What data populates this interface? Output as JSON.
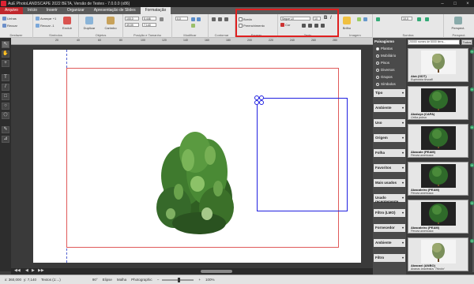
{
  "window": {
    "title": "AuE PhotoLANDSCAPE 2022 BETA, Versão de Testes - 7.0.0.0 (x86)"
  },
  "tabs": [
    {
      "label": "Arquivo",
      "kind": "file"
    },
    {
      "label": "Início",
      "kind": "normal"
    },
    {
      "label": "Inserir",
      "kind": "normal"
    },
    {
      "label": "Organizar",
      "kind": "normal"
    },
    {
      "label": "Apresentação de Slides",
      "kind": "normal"
    },
    {
      "label": "Formatação",
      "kind": "active"
    }
  ],
  "ribbon": {
    "groups": {
      "desfazer": "Desfazer",
      "simbolos": "Símbolos",
      "objetos": "Objetos",
      "posicao": "Posição e Tamanho",
      "modificar": "Modificar",
      "contornar": "Contornar",
      "formas": "Formas",
      "texto": "Texto",
      "imagem": "Imagem",
      "sombra": "Sombra",
      "perspect": "Perspect."
    },
    "items": {
      "linhas": "Linhas",
      "recuar": "Recuar",
      "avancar": "Avançar +1",
      "recuar1": "Recuar -1",
      "excluir": "Excluir",
      "duplicar": "Duplicar",
      "carimbo": "Carimbo",
      "borda": "Borda",
      "preenchimento": "Preenchimento",
      "cor": "Cor",
      "brilho": "Brilho",
      "perspect": "Perspect."
    },
    "font_name": "Segoe UI",
    "font_size": "10",
    "pos_x": "100,0",
    "pos_y": "49,09",
    "width": "5,446",
    "height": "7,140",
    "angle": "0,0",
    "shadow_offset": "10,0"
  },
  "ruler": {
    "ticks": [
      "20",
      "40",
      "60",
      "80",
      "100",
      "120",
      "140",
      "160",
      "180",
      "200",
      "220",
      "240",
      "260",
      "280"
    ]
  },
  "statusbar": {
    "coords": "x: 360,000",
    "coords_y": "y: 7,140",
    "layer": "Textos (1:...)",
    "angle": "90°",
    "snap": "Elipse",
    "grid": "Malha",
    "mode": "Photographic",
    "zoom": "100%"
  },
  "panel": {
    "type_heading": "Paisagismo",
    "types": [
      {
        "label": "Plantas",
        "on": true
      },
      {
        "label": "Mobiliário",
        "on": false
      },
      {
        "label": "Pisos",
        "on": false
      },
      {
        "label": "Diversos",
        "on": false
      },
      {
        "label": "Grupos",
        "on": false
      },
      {
        "label": "Símbolos",
        "on": false
      }
    ],
    "filters": [
      "Tipo",
      "Ambiente",
      "Uso",
      "Origem",
      "Folha",
      "Favoritos",
      "Mais usados",
      "Usado recentemente",
      "Filtro (LMO)",
      "Fornecedor",
      "Ambiente",
      "Filtro"
    ],
    "search": "20000 nomes de 5000 itens...",
    "search_button": "Todos",
    "items": [
      {
        "name": "Abá (ODT)",
        "sci": "Euphorbia tirucalli",
        "light": true
      },
      {
        "name": "Abaluya (CAPA)",
        "sci": "Ceiba pubsa",
        "light": false
      },
      {
        "name": "Abacate (PEAM)",
        "sci": "Persea americana",
        "light": false
      },
      {
        "name": "Abacateiro (PEAM)",
        "sci": "Persea americana",
        "light": false
      },
      {
        "name": "Abacateiro (PEAM)",
        "sci": "Persea americana",
        "light": false
      },
      {
        "name": "Abacaxi (ANBO)",
        "sci": "Ananas bracteatus 'Tricolor'",
        "light": true
      }
    ]
  },
  "colors": {
    "accent_red": "#c0282d",
    "selection_blue": "#2020e0",
    "margin_red": "#e05a5a",
    "plant_green": "#3f7a2e"
  }
}
